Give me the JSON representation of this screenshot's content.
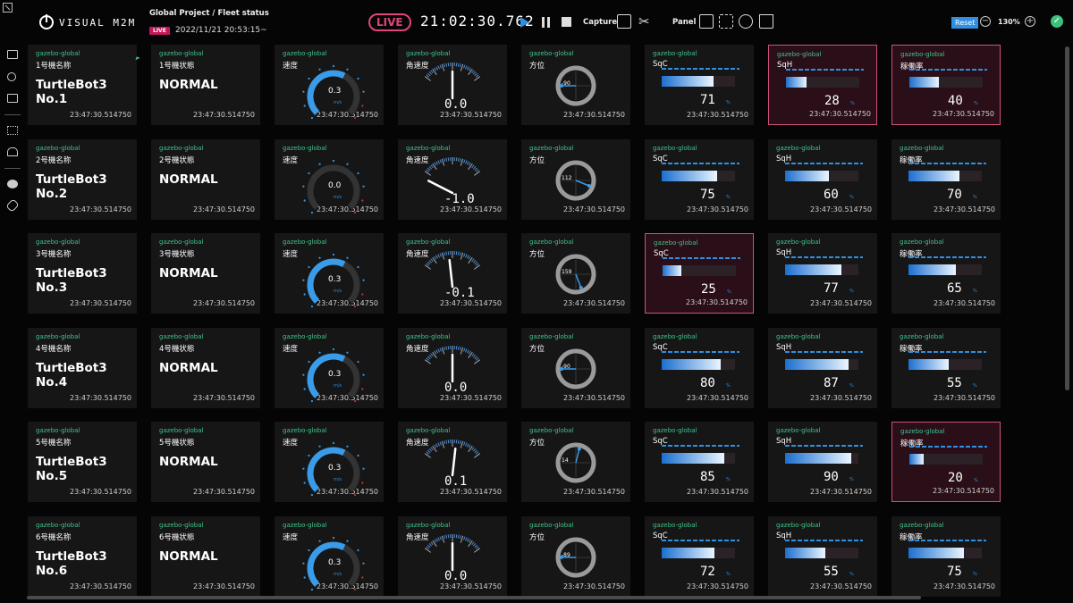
{
  "app": {
    "logo_text": "VISUAL M2M",
    "breadcrumb": "Global Project / Fleet status",
    "live_badge": "LIVE",
    "datetime": "2022/11/21 20:53:15~"
  },
  "toolbar": {
    "live_label": "LIVE",
    "clock": "21:02:30.762",
    "capture_label": "Capture",
    "panel_label": "Panel",
    "reset_label": "Reset",
    "zoom_level": "130%",
    "minus": "−",
    "plus": "+",
    "ok": "✓"
  },
  "colors": {
    "source": "#3fc48b",
    "accent": "#2f8fe0",
    "alert_border": "#d0507d",
    "live": "#e0457b"
  },
  "rows": [
    {
      "source": "gazebo-global",
      "name_label": "1号機名称",
      "name": "TurtleBot3 No.1",
      "state_label": "1号機状態",
      "state": "NORMAL",
      "speed_label": "速度",
      "speed": "0.3",
      "speed_unit": "m/s",
      "speed_fraction": 0.6,
      "ang_label": "角速度",
      "ang": "0.0",
      "ang_value": 0.0,
      "dir_label": "方位",
      "dir": "-90",
      "dir_deg": -90,
      "sqc_label": "SqC",
      "sqc": "71",
      "sqh_label": "SqH",
      "sqh": "28",
      "rate_label": "稼働率",
      "rate": "40",
      "sqc_alert": false,
      "sqh_alert": true,
      "rate_alert": true,
      "ts": "23:47:30.514750"
    },
    {
      "source": "gazebo-global",
      "name_label": "2号機名称",
      "name": "TurtleBot3 No.2",
      "state_label": "2号機状態",
      "state": "NORMAL",
      "speed_label": "速度",
      "speed": "0.0",
      "speed_unit": "m/s",
      "speed_fraction": 0.0,
      "ang_label": "角速度",
      "ang": "-1.0",
      "ang_value": -1.0,
      "dir_label": "方位",
      "dir": "112",
      "dir_deg": 112,
      "sqc_label": "SqC",
      "sqc": "75",
      "sqh_label": "SqH",
      "sqh": "60",
      "rate_label": "稼働率",
      "rate": "70",
      "sqc_alert": false,
      "sqh_alert": false,
      "rate_alert": false,
      "ts": "23:47:30.514750"
    },
    {
      "source": "gazebo-global",
      "name_label": "3号機名称",
      "name": "TurtleBot3 No.3",
      "state_label": "3号機状態",
      "state": "NORMAL",
      "speed_label": "速度",
      "speed": "0.3",
      "speed_unit": "m/s",
      "speed_fraction": 0.6,
      "ang_label": "角速度",
      "ang": "-0.1",
      "ang_value": -0.1,
      "dir_label": "方位",
      "dir": "159",
      "dir_deg": 159,
      "sqc_label": "SqC",
      "sqc": "25",
      "sqh_label": "SqH",
      "sqh": "77",
      "rate_label": "稼働率",
      "rate": "65",
      "sqc_alert": true,
      "sqh_alert": false,
      "rate_alert": false,
      "ts": "23:47:30.514750"
    },
    {
      "source": "gazebo-global",
      "name_label": "4号機名称",
      "name": "TurtleBot3 No.4",
      "state_label": "4号機状態",
      "state": "NORMAL",
      "speed_label": "速度",
      "speed": "0.3",
      "speed_unit": "m/s",
      "speed_fraction": 0.6,
      "ang_label": "角速度",
      "ang": "0.0",
      "ang_value": 0.0,
      "dir_label": "方位",
      "dir": "-90",
      "dir_deg": -90,
      "sqc_label": "SqC",
      "sqc": "80",
      "sqh_label": "SqH",
      "sqh": "87",
      "rate_label": "稼働率",
      "rate": "55",
      "sqc_alert": false,
      "sqh_alert": false,
      "rate_alert": false,
      "ts": "23:47:30.514750"
    },
    {
      "source": "gazebo-global",
      "name_label": "5号機名称",
      "name": "TurtleBot3 No.5",
      "state_label": "5号機状態",
      "state": "NORMAL",
      "speed_label": "速度",
      "speed": "0.3",
      "speed_unit": "m/s",
      "speed_fraction": 0.6,
      "ang_label": "角速度",
      "ang": "0.1",
      "ang_value": 0.1,
      "dir_label": "方位",
      "dir": "14",
      "dir_deg": 14,
      "sqc_label": "SqC",
      "sqc": "85",
      "sqh_label": "SqH",
      "sqh": "90",
      "rate_label": "稼働率",
      "rate": "20",
      "sqc_alert": false,
      "sqh_alert": false,
      "rate_alert": true,
      "ts": "23:47:30.514750"
    },
    {
      "source": "gazebo-global",
      "name_label": "6号機名称",
      "name": "TurtleBot3 No.6",
      "state_label": "6号機状態",
      "state": "NORMAL",
      "speed_label": "速度",
      "speed": "0.3",
      "speed_unit": "m/s",
      "speed_fraction": 0.6,
      "ang_label": "角速度",
      "ang": "0.0",
      "ang_value": 0.0,
      "dir_label": "方位",
      "dir": "-89",
      "dir_deg": -89,
      "sqc_label": "SqC",
      "sqc": "72",
      "sqh_label": "SqH",
      "sqh": "55",
      "rate_label": "稼働率",
      "rate": "75",
      "sqc_alert": false,
      "sqh_alert": false,
      "rate_alert": false,
      "ts": "23:47:30.514750"
    }
  ]
}
